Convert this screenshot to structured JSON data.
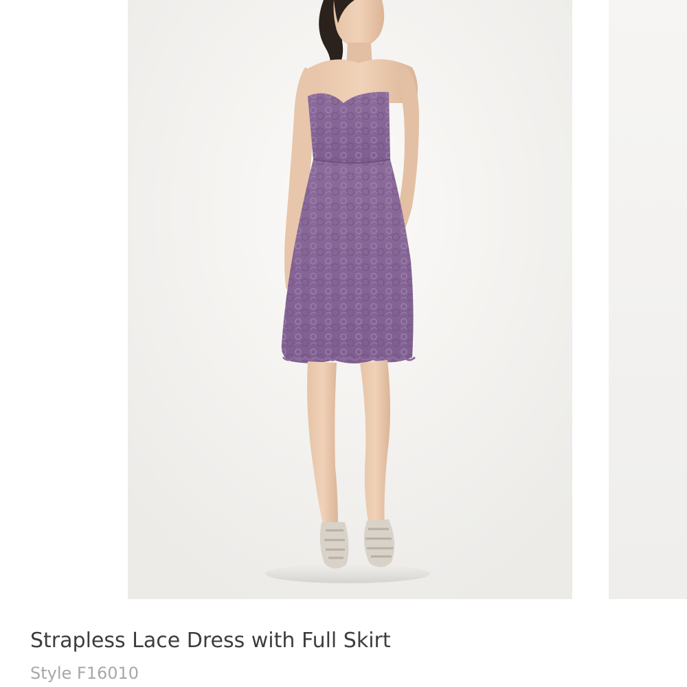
{
  "product": {
    "name": "Strapless Lace Dress with Full Skirt",
    "style": "Style F16010"
  },
  "gallery": {
    "image_alt": "Model wearing strapless purple lace dress with full skirt and silver sandals",
    "dress_color": "#8a6a99"
  }
}
